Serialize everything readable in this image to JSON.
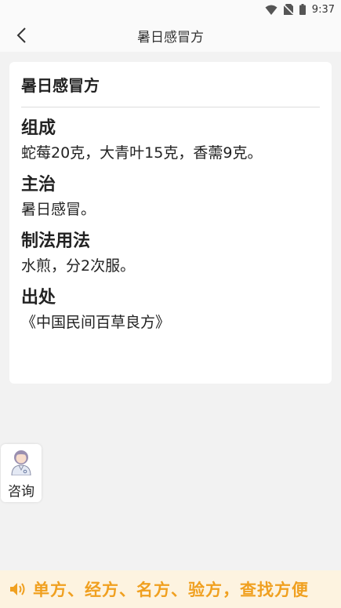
{
  "status_bar": {
    "time": "9:37",
    "icons": [
      "wifi-icon",
      "no-sim-icon",
      "battery-icon"
    ]
  },
  "header": {
    "title": "暑日感冒方",
    "back_icon": "chevron-left-icon"
  },
  "card": {
    "title": "暑日感冒方",
    "sections": [
      {
        "heading": "组成",
        "text": "蛇莓20克，大青叶15克，香薷9克。"
      },
      {
        "heading": "主治",
        "text": "暑日感冒。"
      },
      {
        "heading": "制法用法",
        "text": "水煎，分2次服。"
      },
      {
        "heading": "出处",
        "text": "《中国民间百草良方》"
      }
    ]
  },
  "consult": {
    "label": "咨询",
    "icon": "doctor-avatar-icon"
  },
  "banner": {
    "text": "单方、经方、名方、验方，查找方便",
    "icon": "speaker-icon",
    "color": "#f0a020"
  }
}
